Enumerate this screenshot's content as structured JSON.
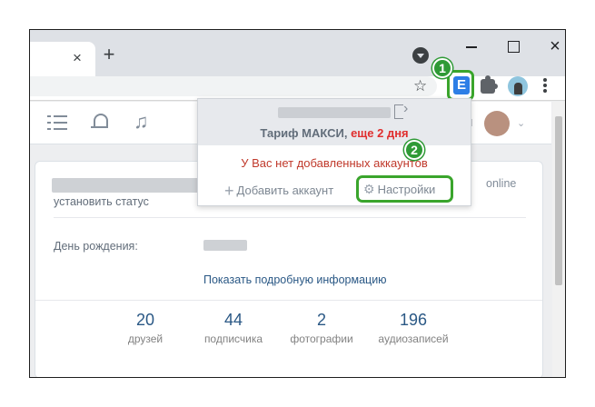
{
  "browser": {
    "tab_close_glyph": "×",
    "new_tab_glyph": "+",
    "window_close_glyph": "×",
    "bookmark_glyph": "☆",
    "extension_letter": "E",
    "icons": [
      "tab-search-icon",
      "minimize-icon",
      "maximize-icon",
      "close-icon",
      "star-icon",
      "extension-icon",
      "puzzle-icon",
      "profile-avatar",
      "menu-icon"
    ]
  },
  "callouts": {
    "step1": "1",
    "step2": "2",
    "color": "#2f9a36"
  },
  "popup": {
    "tariff_label": "Тариф МАКСИ,",
    "tariff_days": "еще 2 дня",
    "no_accounts": "У Вас нет добавленных аккаунтов",
    "add_account": "Добавить аккаунт",
    "settings": "Настройки"
  },
  "header": {
    "icons": [
      "list-icon",
      "bell-icon",
      "music-icon",
      "avatar",
      "chevron-down-icon"
    ],
    "music_glyph": "♫",
    "chevron_glyph": "⌄"
  },
  "profile": {
    "set_status": "установить статус",
    "online": "online",
    "birthday_label": "День рождения:",
    "more_info": "Показать подробную информацию",
    "stats": [
      {
        "value": "20",
        "label": "друзей"
      },
      {
        "value": "44",
        "label": "подписчика"
      },
      {
        "value": "2",
        "label": "фотографии"
      },
      {
        "value": "196",
        "label": "аудиозаписей"
      }
    ]
  },
  "colors": {
    "accent_green": "#3aa52c",
    "vk_link": "#2a5885",
    "warning_red": "#e02e2e"
  }
}
